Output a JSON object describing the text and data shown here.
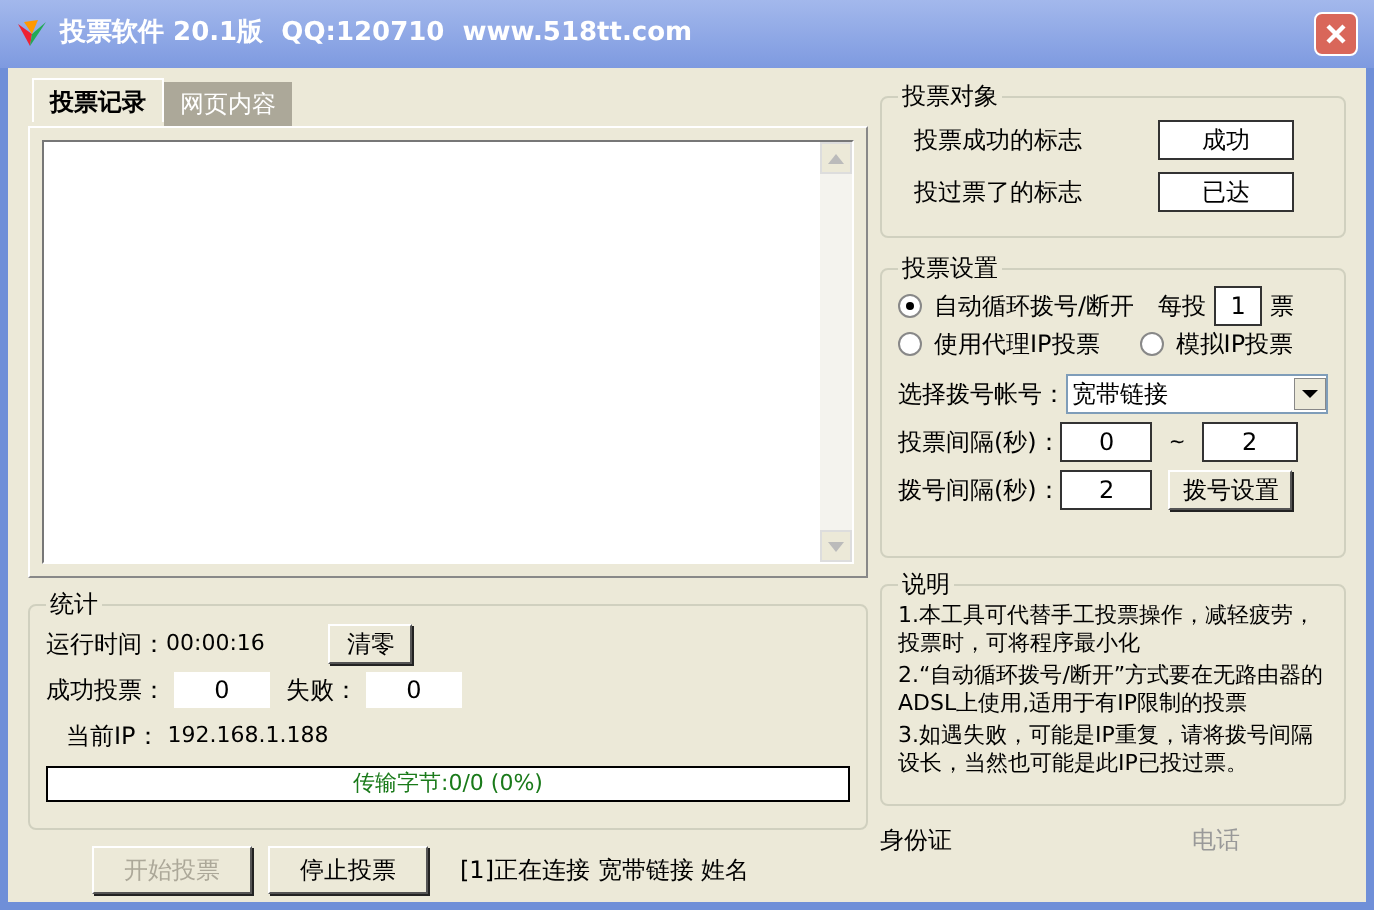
{
  "window": {
    "title": "投票软件 20.1版  QQ:120710  www.518tt.com"
  },
  "tabs": [
    {
      "label": "投票记录",
      "selected": true
    },
    {
      "label": "网页内容",
      "selected": false
    }
  ],
  "target": {
    "title": "投票对象",
    "rows": [
      {
        "label": "投票成功的标志",
        "value": "成功"
      },
      {
        "label": "投过票了的标志",
        "value": "已达"
      }
    ]
  },
  "settings": {
    "title": "投票设置",
    "modes": [
      {
        "label": "自动循环拨号/断开",
        "selected": true
      },
      {
        "label": "使用代理IP投票",
        "selected": false
      },
      {
        "label": "模拟IP投票",
        "selected": false
      }
    ],
    "per_vote": {
      "label": "每投",
      "value": "1",
      "unit": "票"
    },
    "account": {
      "label": "选择拨号帐号：",
      "value": "宽带链接"
    },
    "vote_interval": {
      "label": "投票间隔(秒)：",
      "min": "0",
      "separator": "~",
      "max": "2"
    },
    "dial_interval": {
      "label": "拨号间隔(秒)：",
      "value": "2",
      "button": "拨号设置"
    }
  },
  "stats": {
    "title": "统计",
    "run_time": {
      "label": "运行时间：",
      "value": "00:00:16"
    },
    "clear_button": "清零",
    "success": {
      "label": "成功投票：",
      "value": "0"
    },
    "fail": {
      "label": "失败：",
      "value": "0"
    },
    "ip": {
      "label": "当前IP：",
      "value": "192.168.1.188"
    },
    "progress": {
      "text": "传输字节:0/0 (0%)",
      "level": 0
    }
  },
  "notes": {
    "title": "说明",
    "items": [
      "1.本工具可代替手工投票操作，减轻疲劳，投票时，可将程序最小化",
      "2.“自动循环拨号/断开”方式要在无路由器的ADSL上使用,适用于有IP限制的投票",
      "3.如遇失败，可能是IP重复，请将拨号间隔设长，当然也可能是此IP已投过票。"
    ]
  },
  "buttons": [
    {
      "label": "开始投票",
      "disabled": true
    },
    {
      "label": "停止投票",
      "disabled": false
    }
  ],
  "status": "[1]正在连接 宽带链接 姓名",
  "id_label": "身份证",
  "phone_label": "电话"
}
